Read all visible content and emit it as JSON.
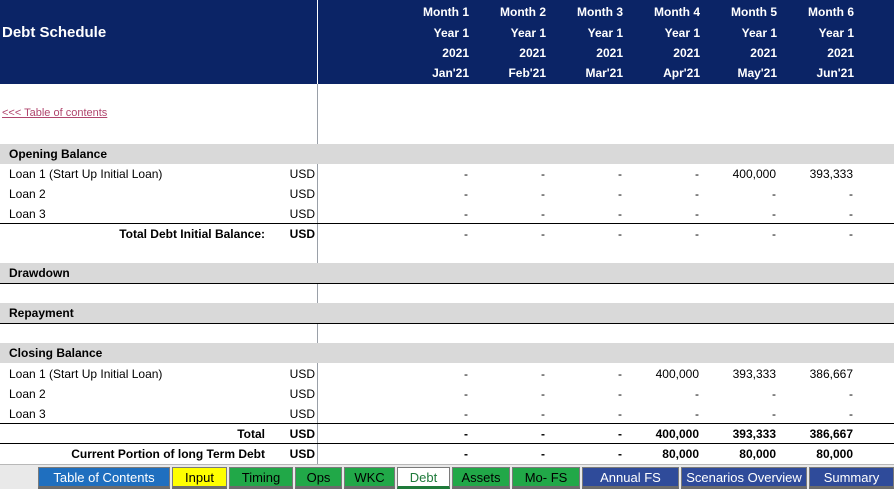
{
  "sheet_title": "Debt Schedule",
  "toc_link": "<<< Table of contents",
  "months": [
    {
      "month": "Month 1",
      "year": "Year 1",
      "yyyy": "2021",
      "mon": "Jan'21"
    },
    {
      "month": "Month 2",
      "year": "Year 1",
      "yyyy": "2021",
      "mon": "Feb'21"
    },
    {
      "month": "Month 3",
      "year": "Year 1",
      "yyyy": "2021",
      "mon": "Mar'21"
    },
    {
      "month": "Month 4",
      "year": "Year 1",
      "yyyy": "2021",
      "mon": "Apr'21"
    },
    {
      "month": "Month 5",
      "year": "Year 1",
      "yyyy": "2021",
      "mon": "May'21"
    },
    {
      "month": "Month 6",
      "year": "Year 1",
      "yyyy": "2021",
      "mon": "Jun'21"
    }
  ],
  "sections": {
    "opening": "Opening Balance",
    "drawdown": "Drawdown",
    "repayment": "Repayment",
    "closing": "Closing Balance"
  },
  "opening_rows": [
    {
      "label": "Loan 1 (Start Up Initial Loan)",
      "unit": "USD",
      "values": [
        "-",
        "-",
        "-",
        "-",
        "400,000",
        "393,333"
      ]
    },
    {
      "label": "Loan 2",
      "unit": "USD",
      "values": [
        "-",
        "-",
        "-",
        "-",
        "-",
        "-"
      ]
    },
    {
      "label": "Loan 3",
      "unit": "USD",
      "values": [
        "-",
        "-",
        "-",
        "-",
        "-",
        "-"
      ]
    }
  ],
  "opening_total": {
    "label": "Total Debt Initial Balance:",
    "unit": "USD",
    "values": [
      "-",
      "-",
      "-",
      "-",
      "-",
      "-"
    ]
  },
  "closing_rows": [
    {
      "label": "Loan 1 (Start Up Initial Loan)",
      "unit": "USD",
      "values": [
        "-",
        "-",
        "-",
        "400,000",
        "393,333",
        "386,667"
      ]
    },
    {
      "label": "Loan 2",
      "unit": "USD",
      "values": [
        "-",
        "-",
        "-",
        "-",
        "-",
        "-"
      ]
    },
    {
      "label": "Loan 3",
      "unit": "USD",
      "values": [
        "-",
        "-",
        "-",
        "-",
        "-",
        "-"
      ]
    }
  ],
  "closing_total": {
    "label": "Total",
    "unit": "USD",
    "values": [
      "-",
      "-",
      "-",
      "400,000",
      "393,333",
      "386,667"
    ]
  },
  "current_portion": {
    "label": "Current Portion of long Term Debt",
    "unit": "USD",
    "values": [
      "-",
      "-",
      "-",
      "80,000",
      "80,000",
      "80,000"
    ]
  },
  "tabs": [
    {
      "label": "Table of Contents",
      "color": "#1f6fbf",
      "text": "#ffffff"
    },
    {
      "label": "Input",
      "color": "#ffff00",
      "text": "#000000"
    },
    {
      "label": "Timing",
      "color": "#21a848",
      "text": "#000000"
    },
    {
      "label": "Ops",
      "color": "#21a848",
      "text": "#000000"
    },
    {
      "label": "WKC",
      "color": "#21a848",
      "text": "#000000"
    },
    {
      "label": "Debt",
      "color": "#ffffff",
      "text": "#1e7a3a",
      "active": true
    },
    {
      "label": "Assets",
      "color": "#21a848",
      "text": "#000000"
    },
    {
      "label": "Mo- FS",
      "color": "#21a848",
      "text": "#000000"
    },
    {
      "label": "Annual FS",
      "color": "#2f4b9a",
      "text": "#ffffff"
    },
    {
      "label": "Scenarios Overview",
      "color": "#2f4b9a",
      "text": "#ffffff"
    },
    {
      "label": "Summary",
      "color": "#2f4b9a",
      "text": "#ffffff"
    }
  ]
}
